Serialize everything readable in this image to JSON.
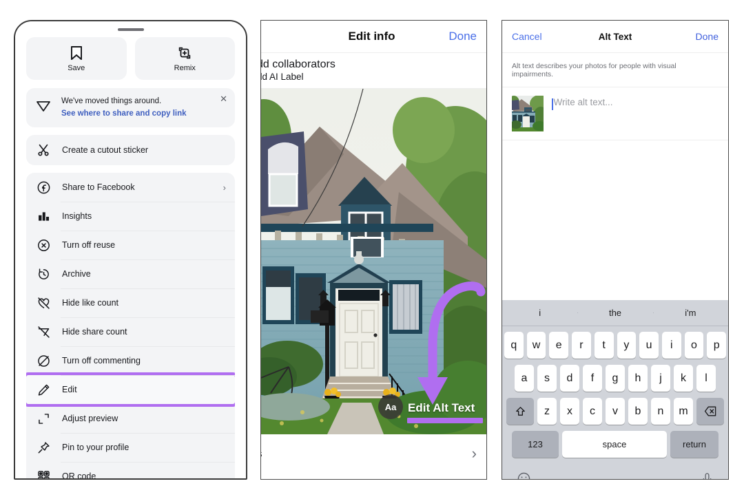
{
  "panel_share_sheet": {
    "quick_actions": [
      {
        "label": "Save",
        "icon": "bookmark-icon"
      },
      {
        "label": "Remix",
        "icon": "remix-icon"
      }
    ],
    "notice": {
      "icon": "paper-plane-icon",
      "line1": "We've moved things around.",
      "line2": "See where to share and copy link",
      "close_icon": "close-icon"
    },
    "cutout": {
      "label": "Create a cutout sticker",
      "icon": "scissors-icon"
    },
    "menu_items": [
      {
        "label": "Share to Facebook",
        "icon": "facebook-icon",
        "chevron": "›",
        "highlighted": false
      },
      {
        "label": "Insights",
        "icon": "insights-bar-chart-icon",
        "chevron": "",
        "highlighted": false
      },
      {
        "label": "Turn off reuse",
        "icon": "circle-x-icon",
        "chevron": "",
        "highlighted": false
      },
      {
        "label": "Archive",
        "icon": "archive-clock-icon",
        "chevron": "",
        "highlighted": false
      },
      {
        "label": "Hide like count",
        "icon": "heart-slash-icon",
        "chevron": "",
        "highlighted": false
      },
      {
        "label": "Hide share count",
        "icon": "send-slash-icon",
        "chevron": "",
        "highlighted": false
      },
      {
        "label": "Turn off commenting",
        "icon": "comment-slash-icon",
        "chevron": "",
        "highlighted": false
      },
      {
        "label": "Edit",
        "icon": "pencil-icon",
        "chevron": "",
        "highlighted": true
      },
      {
        "label": "Adjust preview",
        "icon": "crop-corners-icon",
        "chevron": "",
        "highlighted": false
      },
      {
        "label": "Pin to your profile",
        "icon": "pin-icon",
        "chevron": "",
        "highlighted": false
      },
      {
        "label": "QR code",
        "icon": "qr-code-icon",
        "chevron": "",
        "highlighted": false
      }
    ]
  },
  "panel_edit_info": {
    "title": "Edit info",
    "done_label": "Done",
    "line_collaborators": "dd collaborators",
    "line_ai_label": "dd AI Label",
    "photo_alt_badge": "Aa",
    "edit_alt_text_label": "Edit Alt Text",
    "bottom_row_text": "s",
    "bottom_row_chevron": "›",
    "annotation_color": "#b06ef0"
  },
  "panel_alt_text": {
    "cancel_label": "Cancel",
    "title": "Alt Text",
    "done_label": "Done",
    "description": "Alt text describes your photos for people with visual impairments.",
    "input_placeholder": "Write alt text...",
    "keyboard": {
      "suggestions": [
        "i",
        "the",
        "i'm"
      ],
      "row1": [
        "q",
        "w",
        "e",
        "r",
        "t",
        "y",
        "u",
        "i",
        "o",
        "p"
      ],
      "row2": [
        "a",
        "s",
        "d",
        "f",
        "g",
        "h",
        "j",
        "k",
        "l"
      ],
      "row3": [
        "z",
        "x",
        "c",
        "v",
        "b",
        "n",
        "m"
      ],
      "shift_icon": "shift-up-arrow-icon",
      "backspace_icon": "backspace-icon",
      "numbers_label": "123",
      "space_label": "space",
      "return_label": "return",
      "emoji_icon": "emoji-smiley-icon",
      "mic_icon": "microphone-icon"
    }
  },
  "colors": {
    "accent_purple": "#b06ef0",
    "link_blue": "#4a6fe8",
    "card_grey": "#f3f4f6",
    "keyboard_bg": "#d1d4da"
  }
}
